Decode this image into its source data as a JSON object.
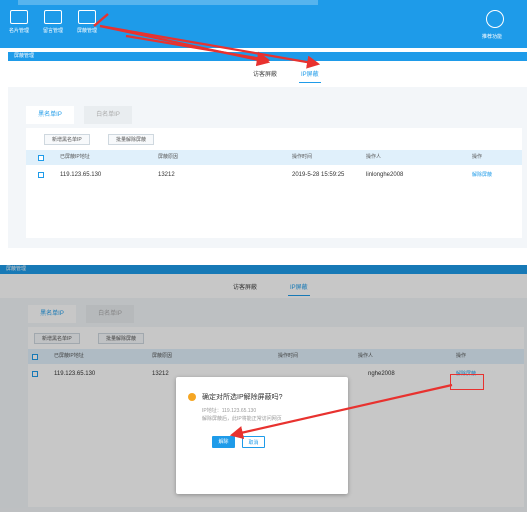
{
  "top_nav": {
    "items": [
      {
        "label": "名片管理",
        "icon": "id-card-icon"
      },
      {
        "label": "留言管理",
        "icon": "envelope-icon"
      },
      {
        "label": "屏蔽管理",
        "icon": "grid-icon"
      }
    ],
    "right_items": [
      {
        "label": "推荐功能",
        "icon": "star-icon"
      }
    ]
  },
  "panel1": {
    "title": "屏蔽管理",
    "tabs": [
      "访客屏蔽",
      "IP屏蔽"
    ],
    "active_tab": "IP屏蔽",
    "subtabs": [
      "黑名单IP",
      "白名单IP"
    ],
    "actions": [
      "新增黑名单IP",
      "批量解除屏蔽"
    ],
    "columns": [
      "已屏蔽IP地址",
      "屏蔽原因",
      "操作时间",
      "操作人",
      "操作"
    ],
    "rows": [
      {
        "ip": "119.123.65.130",
        "reason": "13212",
        "time": "2019-5-28 15:59:25",
        "operator": "linlonghe2008",
        "action": "解除屏蔽"
      }
    ]
  },
  "panel2": {
    "title": "屏蔽管理",
    "tabs": [
      "访客屏蔽",
      "IP屏蔽"
    ],
    "active_tab": "IP屏蔽",
    "subtabs": [
      "黑名单IP",
      "白名单IP"
    ],
    "actions": [
      "新增黑名单IP",
      "批量解除屏蔽"
    ],
    "columns": [
      "已屏蔽IP地址",
      "屏蔽原因",
      "操作时间",
      "操作人",
      "操作"
    ],
    "rows": [
      {
        "ip": "119.123.65.130",
        "reason": "13212",
        "operator": "nghe2008",
        "action": "解除屏蔽"
      }
    ]
  },
  "dialog": {
    "question": "确定对所选IP解除屏蔽吗?",
    "ip_line": "IP地址：119.123.65.130",
    "note_line": "解除屏蔽后，此IP将能正常访问网页",
    "ok_label": "解除",
    "cancel_label": "取消"
  },
  "colors": {
    "accent": "#1e9be9",
    "annotation": "#e8322f",
    "warning": "#f5a623"
  }
}
